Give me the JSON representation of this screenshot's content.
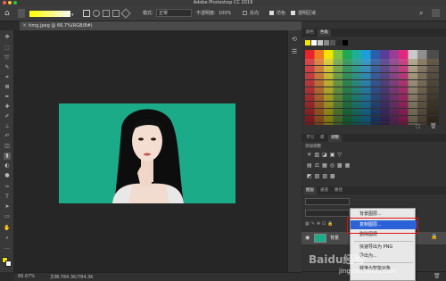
{
  "app": {
    "window_title": "Adobe Photoshop CC 2019"
  },
  "options_bar": {
    "mode_label": "模式:",
    "mode_value": "正常",
    "opacity_label": "不透明度:",
    "opacity_value": "100%",
    "reverse_label": "反向",
    "dither_label": "仿色",
    "transparency_label": "透明区域"
  },
  "document": {
    "tab_title": "timg.jpeg @ 66.7%(RGB/8#)"
  },
  "status_bar": {
    "zoom": "66.67%",
    "doc_info": "文档:784.3K/784.3K"
  },
  "swatches_panel": {
    "tabs": [
      "颜色",
      "色板"
    ],
    "active_tab": "色板"
  },
  "adjustments_panel": {
    "tabs": [
      "学习",
      "库",
      "调整"
    ],
    "active_tab": "调整",
    "add_label": "添加调整"
  },
  "layers_panel": {
    "tabs": [
      "图层",
      "通道",
      "路径"
    ],
    "active_tab": "图层",
    "layer_name": "背景"
  },
  "context_menu": {
    "items": [
      {
        "label": "背景图层...",
        "highlighted": false
      },
      {
        "label": "复制图层...",
        "highlighted": true
      },
      {
        "label": "删除图层",
        "highlighted": false
      },
      {
        "label": "快速导出为 PNG",
        "highlighted": false
      },
      {
        "label": "导出为...",
        "highlighted": false
      },
      {
        "label": "转换为智能对象",
        "highlighted": false
      }
    ]
  },
  "watermark": {
    "brand": "Baidu经验",
    "url": "jingyan.baidu.com"
  },
  "colors": {
    "photo_background": "#1cab89",
    "menu_highlight": "#2c62d8",
    "highlight_box": "#e01010"
  }
}
